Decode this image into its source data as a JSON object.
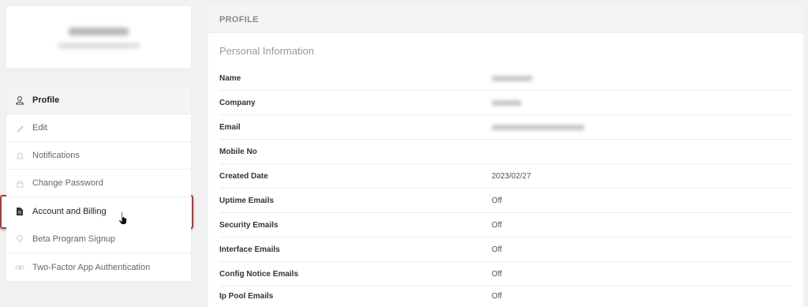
{
  "sidebar": {
    "items": [
      {
        "label": "Profile",
        "icon": "user-icon",
        "glyph": "♙"
      },
      {
        "label": "Edit",
        "icon": "pencil-icon",
        "glyph": "✎"
      },
      {
        "label": "Notifications",
        "icon": "bell-icon",
        "glyph": "♫"
      },
      {
        "label": "Change Password",
        "icon": "lock-icon",
        "glyph": "▭"
      },
      {
        "label": "Account and Billing",
        "icon": "document-icon",
        "glyph": "▤"
      },
      {
        "label": "Beta Program Signup",
        "icon": "bulb-icon",
        "glyph": "◌"
      },
      {
        "label": "Two-Factor App Authentication",
        "icon": "link-icon",
        "glyph": "⇄"
      }
    ]
  },
  "panel": {
    "header": "PROFILE",
    "section_title": "Personal Information",
    "rows": [
      {
        "label": "Name",
        "value": ""
      },
      {
        "label": "Company",
        "value": ""
      },
      {
        "label": "Email",
        "value": ""
      },
      {
        "label": "Mobile No",
        "value": ""
      },
      {
        "label": "Created Date",
        "value": "2023/02/27"
      },
      {
        "label": "Uptime Emails",
        "value": "Off"
      },
      {
        "label": "Security Emails",
        "value": "Off"
      },
      {
        "label": "Interface Emails",
        "value": "Off"
      },
      {
        "label": "Config Notice Emails",
        "value": "Off"
      },
      {
        "label": "Ip Pool Emails",
        "value": "Off"
      }
    ]
  },
  "colors": {
    "highlight_border": "#b03a3a",
    "panel_header_bg": "#f5f5f5"
  }
}
